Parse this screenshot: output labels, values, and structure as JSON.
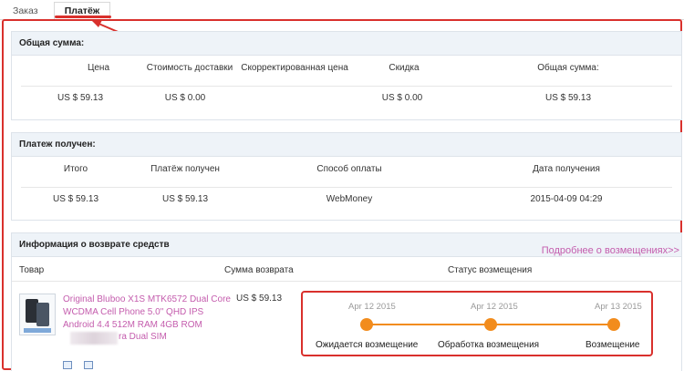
{
  "tabs": [
    "Заказ",
    "Платёж"
  ],
  "total": {
    "title": "Общая сумма:",
    "headers": [
      "Цена",
      "Стоимость доставки",
      "Скорректированная цена",
      "Скидка",
      "Общая сумма:"
    ],
    "values": [
      "US $ 59.13",
      "US $ 0.00",
      "",
      "US $ 0.00",
      "US $ 59.13"
    ]
  },
  "payment": {
    "title": "Платеж получен:",
    "headers": [
      "Итого",
      "Платёж получен",
      "Способ оплаты",
      "Дата получения"
    ],
    "values": [
      "US $ 59.13",
      "US $ 59.13",
      "WebMoney",
      "2015-04-09 04:29"
    ]
  },
  "refund": {
    "title": "Информация о возврате средств",
    "more_link": "Подробнее о возмещениях>>",
    "headers": [
      "Товар",
      "Сумма возврата",
      "Статус возмещения"
    ],
    "product_name": "Original Bluboo X1S MTK6572 Dual Core WCDMA Cell Phone 5.0\" QHD IPS Android 4.4 512M RAM 4GB ROM",
    "product_name_tail": "ra Dual SIM",
    "amount": "US $ 59.13",
    "timeline": [
      {
        "date": "Apr 12 2015",
        "label": "Ожидается возмещение"
      },
      {
        "date": "Apr 12 2015",
        "label": "Обработка возмещения"
      },
      {
        "date": "Apr 13 2015",
        "label": "Возмещение"
      }
    ]
  },
  "colors": {
    "accent": "#d9302c",
    "timeline": "#f28c1d",
    "link": "#c45cad",
    "panel_header": "#eef3f8"
  }
}
